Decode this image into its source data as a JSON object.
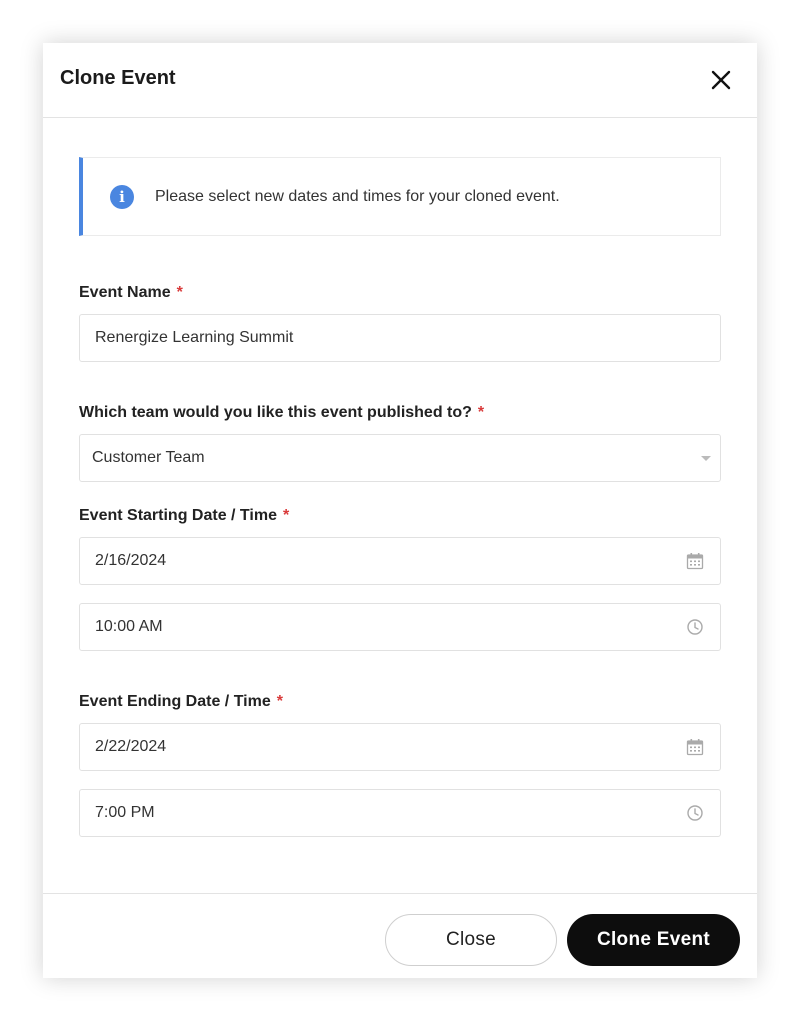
{
  "modal": {
    "title": "Clone Event"
  },
  "info": {
    "message": "Please select new dates and times for your cloned event."
  },
  "fields": {
    "event_name": {
      "label": "Event Name",
      "required_mark": "*",
      "value": "Renergize Learning Summit"
    },
    "team": {
      "label": "Which team would you like this event published to?",
      "required_mark": "*",
      "value": "Customer Team"
    },
    "start": {
      "label": "Event Starting Date / Time",
      "required_mark": "*",
      "date": "2/16/2024",
      "time": "10:00 AM"
    },
    "end": {
      "label": "Event Ending Date / Time",
      "required_mark": "*",
      "date": "2/22/2024",
      "time": "7:00 PM"
    }
  },
  "footer": {
    "close_label": "Close",
    "clone_label": "Clone Event"
  },
  "colors": {
    "accent": "#4a86e0",
    "required": "#d93a3a",
    "primary_button": "#0d0d0d"
  },
  "icons": {
    "close": "close-icon",
    "info": "info-icon",
    "calendar": "calendar-icon",
    "clock": "clock-icon",
    "dropdown": "chevron-down-icon"
  }
}
